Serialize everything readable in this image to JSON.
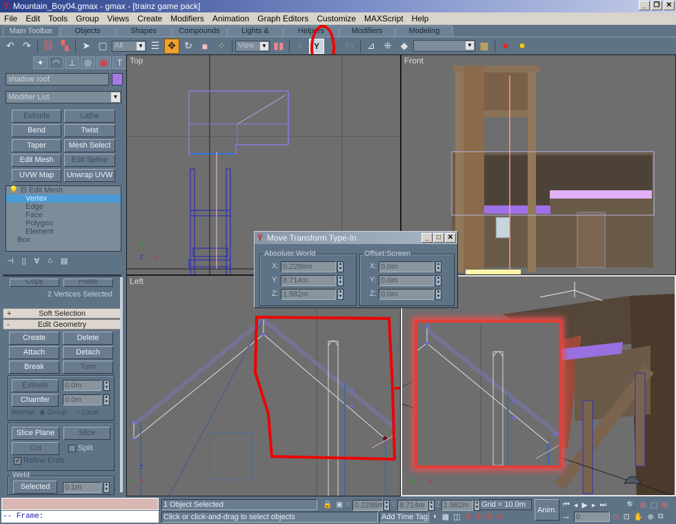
{
  "window": {
    "title": "Mountain_Boy04.gmax - gmax - [trainz game pack]",
    "icon": "gmax-app-icon",
    "controls": {
      "minimize": "_",
      "restore": "❐",
      "close": "✕"
    }
  },
  "menubar": {
    "items": [
      "File",
      "Edit",
      "Tools",
      "Group",
      "Views",
      "Create",
      "Modifiers",
      "Animation",
      "Graph Editors",
      "Customize",
      "MAXScript",
      "Help"
    ]
  },
  "tabs": {
    "items": [
      {
        "label": "Main Toolbar",
        "active": true
      },
      {
        "label": "Objects"
      },
      {
        "label": "Shapes"
      },
      {
        "label": "Compounds"
      },
      {
        "label": "Lights & Cameras"
      },
      {
        "label": "Helpers"
      },
      {
        "label": "Modifiers"
      },
      {
        "label": "Modeling"
      }
    ]
  },
  "toolbar": {
    "selection_filter": "All",
    "reference_coord": "View",
    "named_selection": "",
    "axis_x": "X",
    "axis_y": "Y",
    "axis_z": "Z",
    "axis_xy": "XY",
    "icons": [
      "undo-icon",
      "redo-icon",
      "link-icon",
      "unlink-icon",
      "select-icon",
      "region-select-icon",
      "select-by-name-icon",
      "move-icon",
      "rotate-icon",
      "scale-icon",
      "pivot-icon",
      "mirror-icon",
      "align-icon",
      "spacing-icon",
      "named-sets-icon",
      "render-icon",
      "material-icon"
    ],
    "active_tool": "move-icon",
    "active_axis": "Y"
  },
  "command_panel": {
    "tabs": [
      "create-icon",
      "modify-icon",
      "hierarchy-icon",
      "motion-icon",
      "display-icon",
      "utilities-icon"
    ],
    "active_tab": "modify-icon",
    "object_name": "shadow roof",
    "object_color": "#a57ae8",
    "modifier_list": "Modifier List",
    "modifier_buttons": [
      {
        "label": "Extrude",
        "disabled": true
      },
      {
        "label": "Lathe",
        "disabled": true
      },
      {
        "label": "Bend"
      },
      {
        "label": "Twist"
      },
      {
        "label": "Taper"
      },
      {
        "label": "Mesh Select"
      },
      {
        "label": "Edit Mesh"
      },
      {
        "label": "Edit Spline",
        "disabled": true
      },
      {
        "label": "UVW Map"
      },
      {
        "label": "Unwrap UVW"
      }
    ],
    "stack": {
      "items": [
        "Edit Mesh",
        "Vertex",
        "Edge",
        "Face",
        "Polygon",
        "Element",
        "Box"
      ],
      "selected": "Vertex"
    },
    "stack_icons": [
      "pin-stack-icon",
      "show-end-result-icon",
      "make-unique-icon",
      "remove-modifier-icon",
      "configure-sets-icon"
    ],
    "copy_label": "Copy",
    "paste_label": "Paste",
    "selection_status": "2 Vertices Selected",
    "soft_selection": {
      "label": "Soft Selection",
      "toggle": "+"
    },
    "edit_geometry": {
      "label": "Edit Geometry",
      "toggle": "-",
      "buttons": [
        {
          "label": "Create"
        },
        {
          "label": "Delete"
        },
        {
          "label": "Attach"
        },
        {
          "label": "Detach"
        },
        {
          "label": "Break"
        },
        {
          "label": "Turn",
          "disabled": true
        }
      ],
      "extrude": {
        "label": "Extrude",
        "value": "0.0m",
        "disabled": true
      },
      "chamfer": {
        "label": "Chamfer",
        "value": "0.0m"
      },
      "normal_label": "Normal:",
      "normal_options": [
        "Group",
        "Local"
      ],
      "normal_selected": "Group",
      "slice_plane": "Slice Plane",
      "slice": "Slice",
      "cut": "Cut",
      "split": {
        "label": "Split",
        "checked": false
      },
      "refine_ends": {
        "label": "Refine Ends",
        "checked": true
      },
      "weld": {
        "label": "Weld",
        "selected_button": "Selected",
        "value": "0.1m"
      }
    }
  },
  "viewports": {
    "top": {
      "label": "Top"
    },
    "front": {
      "label": "Front"
    },
    "left": {
      "label": "Left"
    },
    "perspective": {
      "label": ""
    }
  },
  "dialog": {
    "title": "Move Transform Type-In",
    "absolute": {
      "label": "Absolute:World",
      "x": "0.2286m",
      "y": "8.714m",
      "z": "1.982m"
    },
    "offset": {
      "label": "Offset:Screen",
      "x": "0.0m",
      "y": "0.0m",
      "z": "0.0m"
    },
    "axis_labels": {
      "x": "X:",
      "y": "Y:",
      "z": "Z:"
    }
  },
  "maxscript": {
    "listener_text": "",
    "output_text": "-- Frame:"
  },
  "statusbar": {
    "selection": "1 Object Selected",
    "prompt": "Click or click-and-drag to select objects",
    "x_label": "X",
    "x": "0.2286m",
    "y_label": "Y",
    "y": "8.714m",
    "z_label": "Z",
    "z": "1.982m",
    "grid": "Grid = 10.0m",
    "add_time_tag": "Add Time Tag",
    "anim_button": "Anim.",
    "frame": "0"
  }
}
